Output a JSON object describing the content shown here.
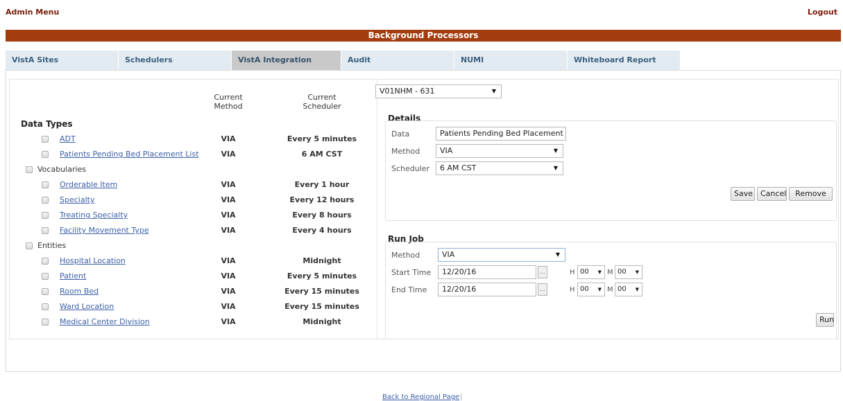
{
  "header": {
    "admin_menu": "Admin Menu",
    "logout": "Logout"
  },
  "banner": "Background Processors",
  "tabs": [
    "VistA Sites",
    "Schedulers",
    "VistA Integration",
    "Audit",
    "NUMI",
    "Whiteboard Report"
  ],
  "active_tab": "VistA Integration",
  "columns": {
    "method_l1": "Current",
    "method_l2": "Method",
    "sched_l1": "Current",
    "sched_l2": "Scheduler"
  },
  "site_select": "V01NHM - 631",
  "data_types": {
    "title": "Data Types",
    "groups": [
      {
        "label": "",
        "items": [
          {
            "name": "ADT",
            "method": "VIA",
            "scheduler": "Every 5 minutes"
          },
          {
            "name": "Patients Pending Bed Placement List",
            "method": "VIA",
            "scheduler": "6 AM CST"
          }
        ]
      },
      {
        "label": "Vocabularies",
        "items": [
          {
            "name": "Orderable Item",
            "method": "VIA",
            "scheduler": "Every 1 hour"
          },
          {
            "name": "Specialty",
            "method": "VIA",
            "scheduler": "Every 12 hours"
          },
          {
            "name": "Treating Specialty",
            "method": "VIA",
            "scheduler": "Every 8 hours"
          },
          {
            "name": "Facility Movement Type",
            "method": "VIA",
            "scheduler": "Every 4 hours"
          }
        ]
      },
      {
        "label": "Entities",
        "items": [
          {
            "name": "Hospital Location",
            "method": "VIA",
            "scheduler": "Midnight"
          },
          {
            "name": "Patient",
            "method": "VIA",
            "scheduler": "Every 5 minutes"
          },
          {
            "name": "Room Bed",
            "method": "VIA",
            "scheduler": "Every 15 minutes"
          },
          {
            "name": "Ward Location",
            "method": "VIA",
            "scheduler": "Every 15 minutes"
          },
          {
            "name": "Medical Center Division",
            "method": "VIA",
            "scheduler": "Midnight"
          }
        ]
      }
    ]
  },
  "details": {
    "title": "Details",
    "data_label": "Data",
    "data_value": "Patients Pending Bed Placement L",
    "method_label": "Method",
    "method_value": "VIA",
    "scheduler_label": "Scheduler",
    "scheduler_value": "6 AM CST",
    "save": "Save",
    "cancel": "Cancel",
    "remove": "Remove"
  },
  "run_job": {
    "title": "Run Job",
    "method_label": "Method",
    "method_value": "VIA",
    "start_label": "Start Time",
    "start_value": "12/20/16",
    "end_label": "End Time",
    "end_value": "12/20/16",
    "cal_glyph": "...",
    "h": "H",
    "m": "M",
    "hour": "00",
    "minute": "00",
    "run": "Run"
  },
  "footer": {
    "back_link": "Back to Regional Page",
    "separator": "|"
  }
}
